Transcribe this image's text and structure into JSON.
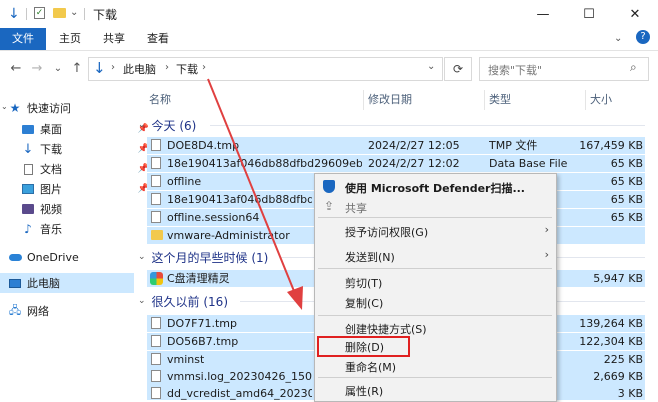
{
  "titlebar": {
    "title": "下载",
    "minimize": "—",
    "maximize": "☐",
    "close": "✕"
  },
  "ribbon": {
    "tabs": [
      "文件",
      "主页",
      "共享",
      "查看"
    ],
    "help": "?"
  },
  "nav": {
    "back": "←",
    "forward": "→",
    "recent": "⌄",
    "up": "↑",
    "breadcrumb": [
      "此电脑",
      "下载"
    ],
    "search_placeholder": "搜索\"下载\""
  },
  "sidebar": {
    "items": [
      {
        "label": "快速访问",
        "icon": "star-icon"
      },
      {
        "label": "桌面",
        "icon": "desktop-icon",
        "pinned": true
      },
      {
        "label": "下载",
        "icon": "download-icon",
        "pinned": true
      },
      {
        "label": "文档",
        "icon": "document-icon",
        "pinned": true
      },
      {
        "label": "图片",
        "icon": "picture-icon",
        "pinned": true
      },
      {
        "label": "视频",
        "icon": "video-icon"
      },
      {
        "label": "音乐",
        "icon": "music-icon"
      },
      {
        "label": "OneDrive",
        "icon": "cloud-icon"
      },
      {
        "label": "此电脑",
        "icon": "computer-icon",
        "selected": true
      },
      {
        "label": "网络",
        "icon": "network-icon"
      }
    ]
  },
  "columns": [
    "名称",
    "修改日期",
    "类型",
    "大小"
  ],
  "groups": [
    {
      "title": "今天 (6)"
    },
    {
      "title": "这个月的早些时候 (1)"
    },
    {
      "title": "很久以前 (16)"
    }
  ],
  "files_today": [
    {
      "name": "DOE8D4.tmp",
      "date": "2024/2/27 12:05",
      "type": "TMP 文件",
      "size": "167,459 KB"
    },
    {
      "name": "18e190413af046db88dfbd29609eb877",
      "date": "2024/2/27 12:02",
      "type": "Data Base File",
      "size": "65 KB"
    },
    {
      "name": "offline",
      "date": "",
      "type": "",
      "size": "65 KB"
    },
    {
      "name": "18e190413af046db88dfbd2960",
      "date": "",
      "type": "",
      "size": "65 KB"
    },
    {
      "name": "offline.session64",
      "date": "",
      "type": "",
      "size": "65 KB"
    },
    {
      "name": "vmware-Administrator",
      "date": "",
      "type": "",
      "size": ""
    }
  ],
  "files_month": [
    {
      "name": "C盘清理精灵",
      "date": "",
      "type": "",
      "size": "5,947 KB"
    }
  ],
  "files_old": [
    {
      "name": "DO7F71.tmp",
      "date": "",
      "type": "",
      "size": "139,264 KB"
    },
    {
      "name": "DO56B7.tmp",
      "date": "",
      "type": "",
      "size": "122,304 KB"
    },
    {
      "name": "vminst",
      "date": "",
      "type": "",
      "size": "225 KB"
    },
    {
      "name": "vmmsi.log_20230426_150437",
      "date": "",
      "type": "",
      "size": "2,669 KB"
    },
    {
      "name": "dd_vcredist_amd64_20230426",
      "date": "",
      "type": "",
      "size": "3 KB"
    }
  ],
  "context_menu": {
    "items": [
      {
        "label": "使用 Microsoft Defender扫描...",
        "icon": "defender-shield-icon",
        "bold": true
      },
      {
        "label": "共享",
        "icon": "share-icon",
        "disabled": true
      },
      {
        "label": "授予访问权限(G)",
        "submenu": true
      },
      {
        "label": "发送到(N)",
        "submenu": true
      },
      {
        "label": "剪切(T)"
      },
      {
        "label": "复制(C)"
      },
      {
        "label": "创建快捷方式(S)"
      },
      {
        "label": "删除(D)",
        "highlight": true
      },
      {
        "label": "重命名(M)"
      },
      {
        "label": "属性(R)"
      }
    ]
  },
  "colors": {
    "accent": "#1a67c0",
    "selection": "#cce8ff",
    "highlight_box": "#e02020",
    "arrow": "#e04040"
  }
}
